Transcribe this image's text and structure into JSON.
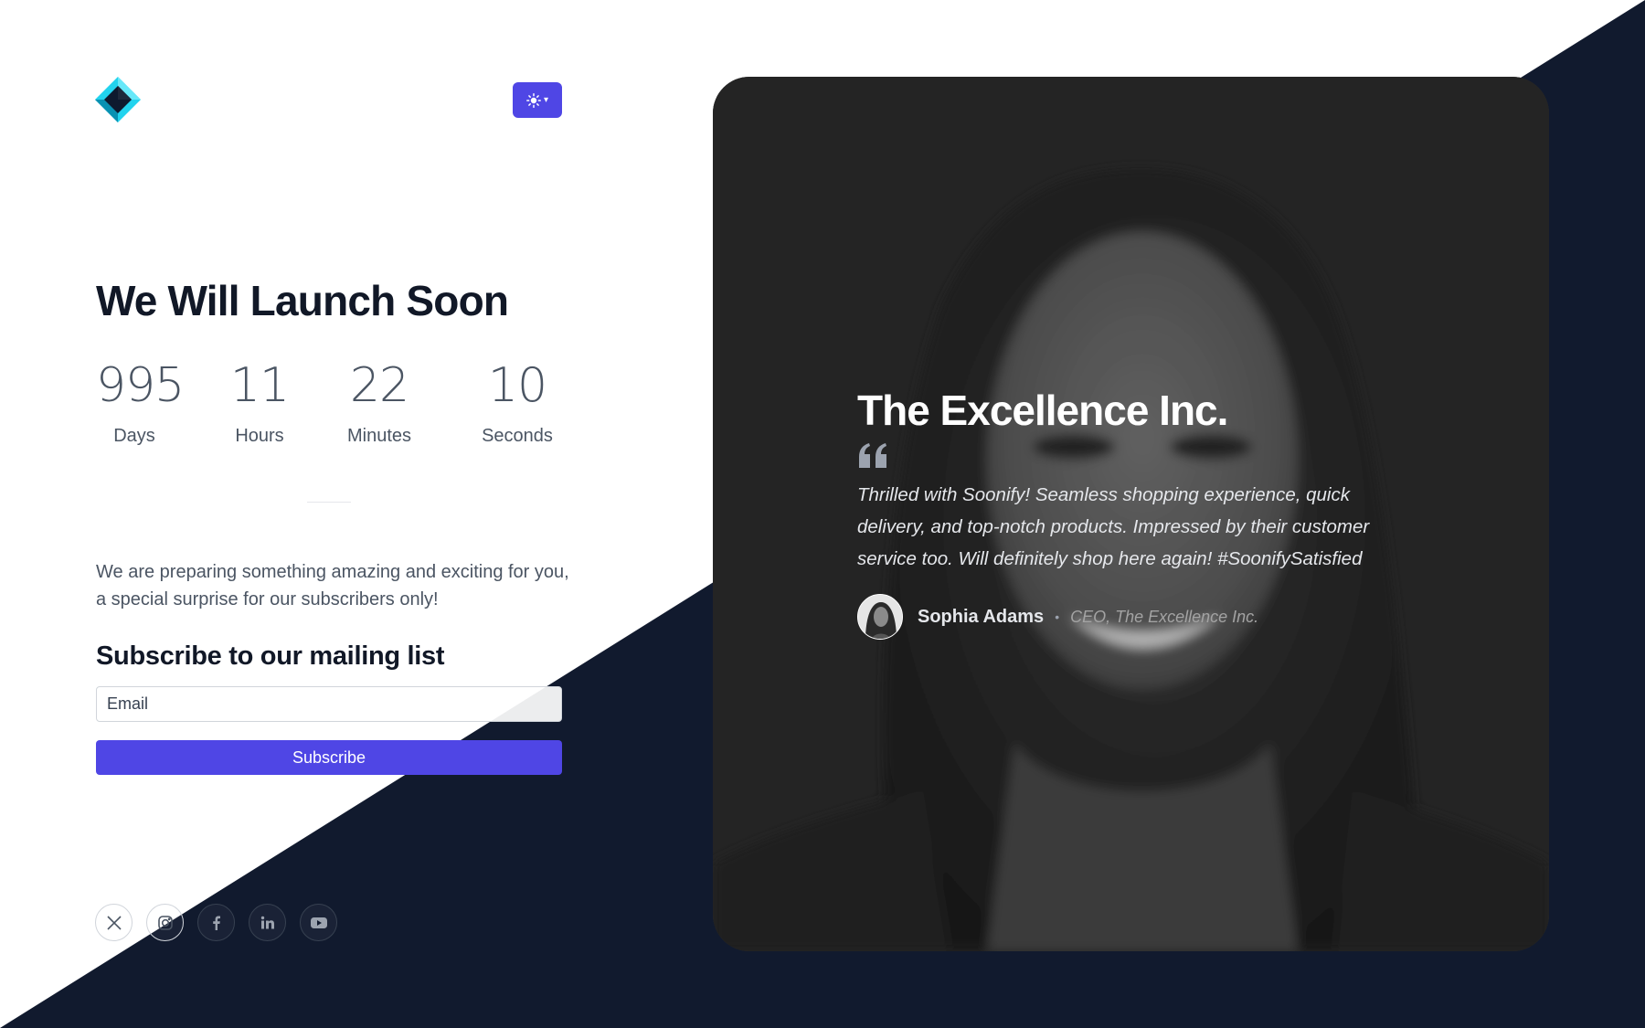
{
  "header": {
    "logo_icon": "diamond-logo-icon",
    "theme_toggle_icon": "sun-icon",
    "theme_toggle_caret": "▾"
  },
  "main": {
    "title": "We Will Launch Soon",
    "countdown": [
      {
        "value": "995",
        "label": "Days"
      },
      {
        "value": "11",
        "label": "Hours"
      },
      {
        "value": "22",
        "label": "Minutes"
      },
      {
        "value": "10",
        "label": "Seconds"
      }
    ],
    "intro": "We are preparing something amazing and exciting for you, a special surprise for our subscribers only!",
    "subscribe_heading": "Subscribe to our mailing list",
    "email_placeholder": "Email",
    "subscribe_label": "Subscribe"
  },
  "socials": [
    {
      "icon": "x-twitter-icon"
    },
    {
      "icon": "instagram-icon"
    },
    {
      "icon": "facebook-icon"
    },
    {
      "icon": "linkedin-icon"
    },
    {
      "icon": "youtube-icon"
    }
  ],
  "testimonial": {
    "company": "The Excellence Inc.",
    "quote": "Thrilled with Soonify! Seamless shopping experience, quick delivery, and top-notch products. Impressed by their customer service too. Will definitely shop here again! #SoonifySatisfied",
    "author_name": "Sophia Adams",
    "separator": "•",
    "author_role": "CEO, The Excellence Inc."
  },
  "colors": {
    "primary": "#4f46e5",
    "dark_navy": "#111a2e",
    "heading": "#111827",
    "muted_text": "#4b5563",
    "logo_cyan": "#22d3ee"
  }
}
